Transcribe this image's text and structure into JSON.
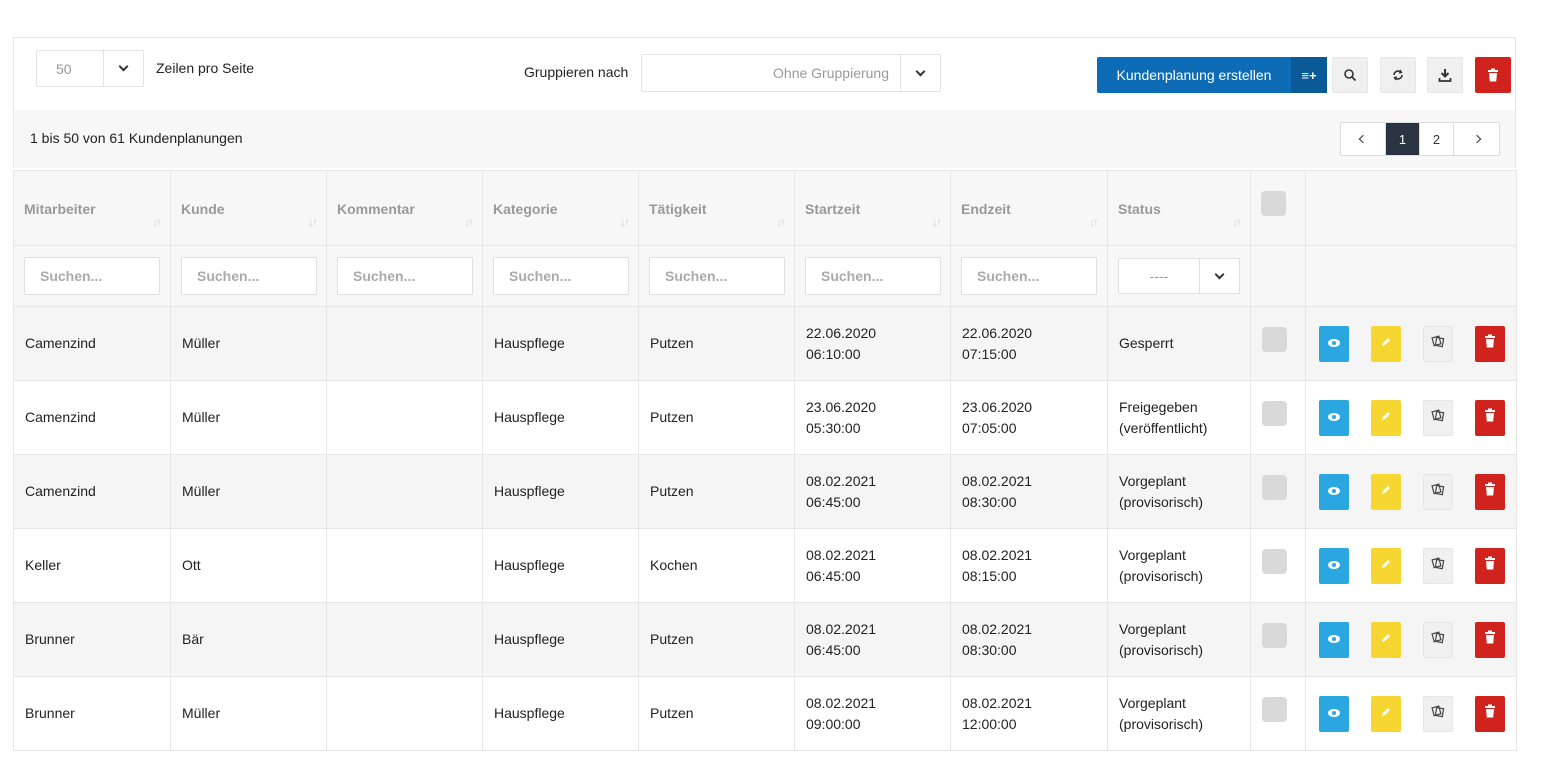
{
  "toolbar": {
    "rows_value": "50",
    "rows_label": "Zeilen pro Seite",
    "group_label": "Gruppieren nach",
    "group_value": "Ohne Gruppierung",
    "create_button": "Kundenplanung erstellen",
    "create_addon": "≡+"
  },
  "info": {
    "count_text": "1 bis 50 von 61 Kundenplanungen",
    "pages": [
      "1",
      "2"
    ],
    "active_page": "1"
  },
  "table": {
    "headers": [
      "Mitarbeiter",
      "Kunde",
      "Kommentar",
      "Kategorie",
      "Tätigkeit",
      "Startzeit",
      "Endzeit",
      "Status"
    ],
    "search_placeholder": "Suchen...",
    "status_filter_value": "----",
    "rows": [
      {
        "mitarbeiter": "Camenzind",
        "kunde": "Müller",
        "kommentar": "",
        "kategorie": "Hauspflege",
        "taetigkeit": "Putzen",
        "start_date": "22.06.2020",
        "start_time": "06:10:00",
        "end_date": "22.06.2020",
        "end_time": "07:15:00",
        "status_1": "Gesperrt",
        "status_2": ""
      },
      {
        "mitarbeiter": "Camenzind",
        "kunde": "Müller",
        "kommentar": "",
        "kategorie": "Hauspflege",
        "taetigkeit": "Putzen",
        "start_date": "23.06.2020",
        "start_time": "05:30:00",
        "end_date": "23.06.2020",
        "end_time": "07:05:00",
        "status_1": "Freigegeben",
        "status_2": "(veröffentlicht)"
      },
      {
        "mitarbeiter": "Camenzind",
        "kunde": "Müller",
        "kommentar": "",
        "kategorie": "Hauspflege",
        "taetigkeit": "Putzen",
        "start_date": "08.02.2021",
        "start_time": "06:45:00",
        "end_date": "08.02.2021",
        "end_time": "08:30:00",
        "status_1": "Vorgeplant",
        "status_2": "(provisorisch)"
      },
      {
        "mitarbeiter": "Keller",
        "kunde": "Ott",
        "kommentar": "",
        "kategorie": "Hauspflege",
        "taetigkeit": "Kochen",
        "start_date": "08.02.2021",
        "start_time": "06:45:00",
        "end_date": "08.02.2021",
        "end_time": "08:15:00",
        "status_1": "Vorgeplant",
        "status_2": "(provisorisch)"
      },
      {
        "mitarbeiter": "Brunner",
        "kunde": "Bär",
        "kommentar": "",
        "kategorie": "Hauspflege",
        "taetigkeit": "Putzen",
        "start_date": "08.02.2021",
        "start_time": "06:45:00",
        "end_date": "08.02.2021",
        "end_time": "08:30:00",
        "status_1": "Vorgeplant",
        "status_2": "(provisorisch)"
      },
      {
        "mitarbeiter": "Brunner",
        "kunde": "Müller",
        "kommentar": "",
        "kategorie": "Hauspflege",
        "taetigkeit": "Putzen",
        "start_date": "08.02.2021",
        "start_time": "09:00:00",
        "end_date": "08.02.2021",
        "end_time": "12:00:00",
        "status_1": "Vorgeplant",
        "status_2": "(provisorisch)"
      }
    ]
  },
  "icons": {
    "search": "search-icon",
    "refresh": "refresh-icon",
    "download": "download-icon",
    "delete": "trash-icon",
    "view": "eye-icon",
    "edit": "pencil-icon",
    "copy": "copy-icon"
  },
  "colors": {
    "primary": "#0d6cb5",
    "view": "#2aa6e0",
    "edit": "#f6d631",
    "delete": "#d0231e",
    "active_page": "#2a3340"
  }
}
